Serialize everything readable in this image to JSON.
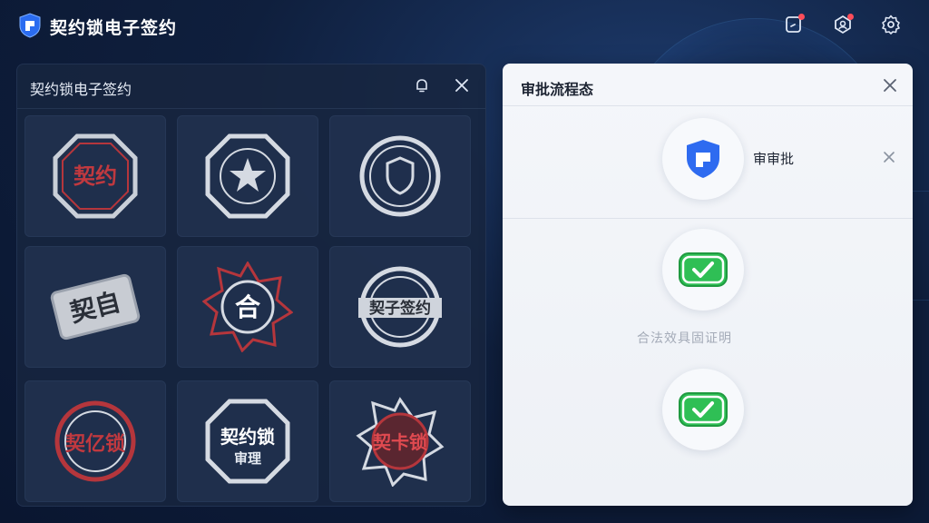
{
  "app": {
    "title": "契约锁电子签约",
    "accent": "#2b6cf0",
    "alert_color": "#ff4d5a"
  },
  "top_icons": [
    "notification-icon",
    "team-icon",
    "settings-icon"
  ],
  "left_panel": {
    "title": "契约锁电子签约",
    "seals": [
      {
        "text": "契约",
        "style": "red-gray",
        "shape": "octagon"
      },
      {
        "text": "",
        "style": "gray",
        "shape": "octagon-star"
      },
      {
        "text": "",
        "style": "gray",
        "shape": "circle-shield"
      },
      {
        "text": "契自",
        "style": "gray",
        "shape": "rect"
      },
      {
        "text": "合",
        "style": "red-gray",
        "shape": "star"
      },
      {
        "text": "契子签约",
        "style": "gray",
        "shape": "circle-banner"
      },
      {
        "text": "契亿锁",
        "style": "red",
        "shape": "circle"
      },
      {
        "text": "契约锁",
        "style": "gray",
        "shape": "octagon"
      },
      {
        "text": "契卡锁",
        "style": "red",
        "shape": "star"
      }
    ],
    "seal_subtexts": [
      "",
      "",
      "",
      "",
      "",
      "",
      "",
      "审理",
      ""
    ]
  },
  "right_panel": {
    "title": "审批流程态",
    "steps": [
      {
        "label": "审审批",
        "icon": "shield-icon",
        "status": "active"
      },
      {
        "label": "",
        "icon": "check-icon",
        "status": "approved"
      },
      {
        "label": "",
        "icon": "check-icon",
        "status": "approved"
      }
    ],
    "faint_text": "合法效具固证明"
  }
}
